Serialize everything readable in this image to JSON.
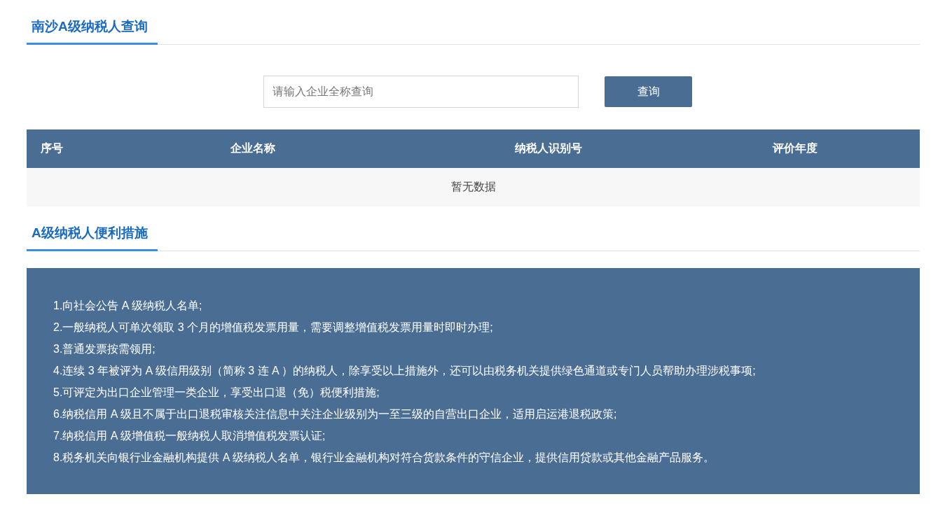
{
  "query_section": {
    "title": "南沙A级纳税人查询"
  },
  "search": {
    "placeholder": "请输入企业全称查询",
    "button": "查询"
  },
  "table": {
    "columns": [
      "序号",
      "企业名称",
      "纳税人识别号",
      "评价年度"
    ],
    "empty_text": "暂无数据"
  },
  "measures_section": {
    "title": "A级纳税人便利措施",
    "items": [
      "1.向社会公告 A 级纳税人名单;",
      "2.一般纳税人可单次领取 3 个月的增值税发票用量，需要调整增值税发票用量时即时办理;",
      "3.普通发票按需领用;",
      "4.连续 3 年被评为 A 级信用级别（简称 3 连 A ）的纳税人，除享受以上措施外，还可以由税务机关提供绿色通道或专门人员帮助办理涉税事项;",
      "5.可评定为出口企业管理一类企业，享受出口退（免）税便利措施;",
      "6.纳税信用 A 级且不属于出口退税审核关注信息中关注企业级别为一至三级的自营出口企业，适用启运港退税政策;",
      "7.纳税信用 A 级增值税一般纳税人取消增值税发票认证;",
      "8.税务机关向银行业金融机构提供 A 级纳税人名单，银行业金融机构对符合货款条件的守信企业，提供信用贷款或其他金融产品服务。"
    ]
  }
}
